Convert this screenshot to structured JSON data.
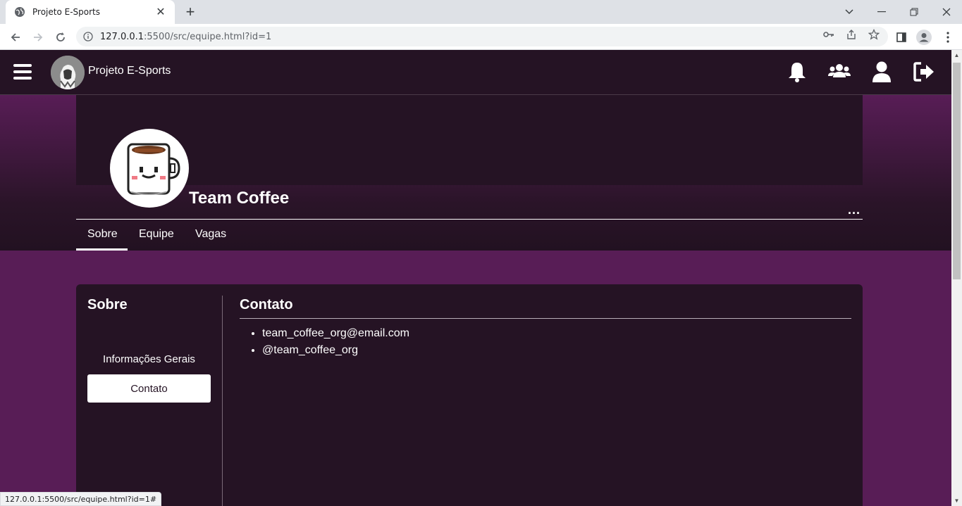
{
  "browser": {
    "tab_title": "Projeto E-Sports",
    "url_host": "127.0.0.1",
    "url_path": ":5500/src/equipe.html?id=1",
    "status_url": "127.0.0.1:5500/src/equipe.html?id=1#"
  },
  "navbar": {
    "brand_name": "Projeto E-Sports",
    "icons": [
      "menu-icon",
      "bell-icon",
      "users-icon",
      "user-icon",
      "logout-icon"
    ]
  },
  "team": {
    "name": "Team Coffee",
    "more_label": "..."
  },
  "tabs": [
    {
      "label": "Sobre",
      "active": true
    },
    {
      "label": "Equipe",
      "active": false
    },
    {
      "label": "Vagas",
      "active": false
    }
  ],
  "sidebar": {
    "title": "Sobre",
    "items": [
      {
        "label": "Informações Gerais",
        "active": false
      },
      {
        "label": "Contato",
        "active": true
      }
    ]
  },
  "contact": {
    "title": "Contato",
    "items": [
      "team_coffee_org@email.com",
      "@team_coffee_org"
    ]
  },
  "colors": {
    "page_bg": "#581d56",
    "navbar_bg": "#251324",
    "card_bg": "#251324"
  }
}
